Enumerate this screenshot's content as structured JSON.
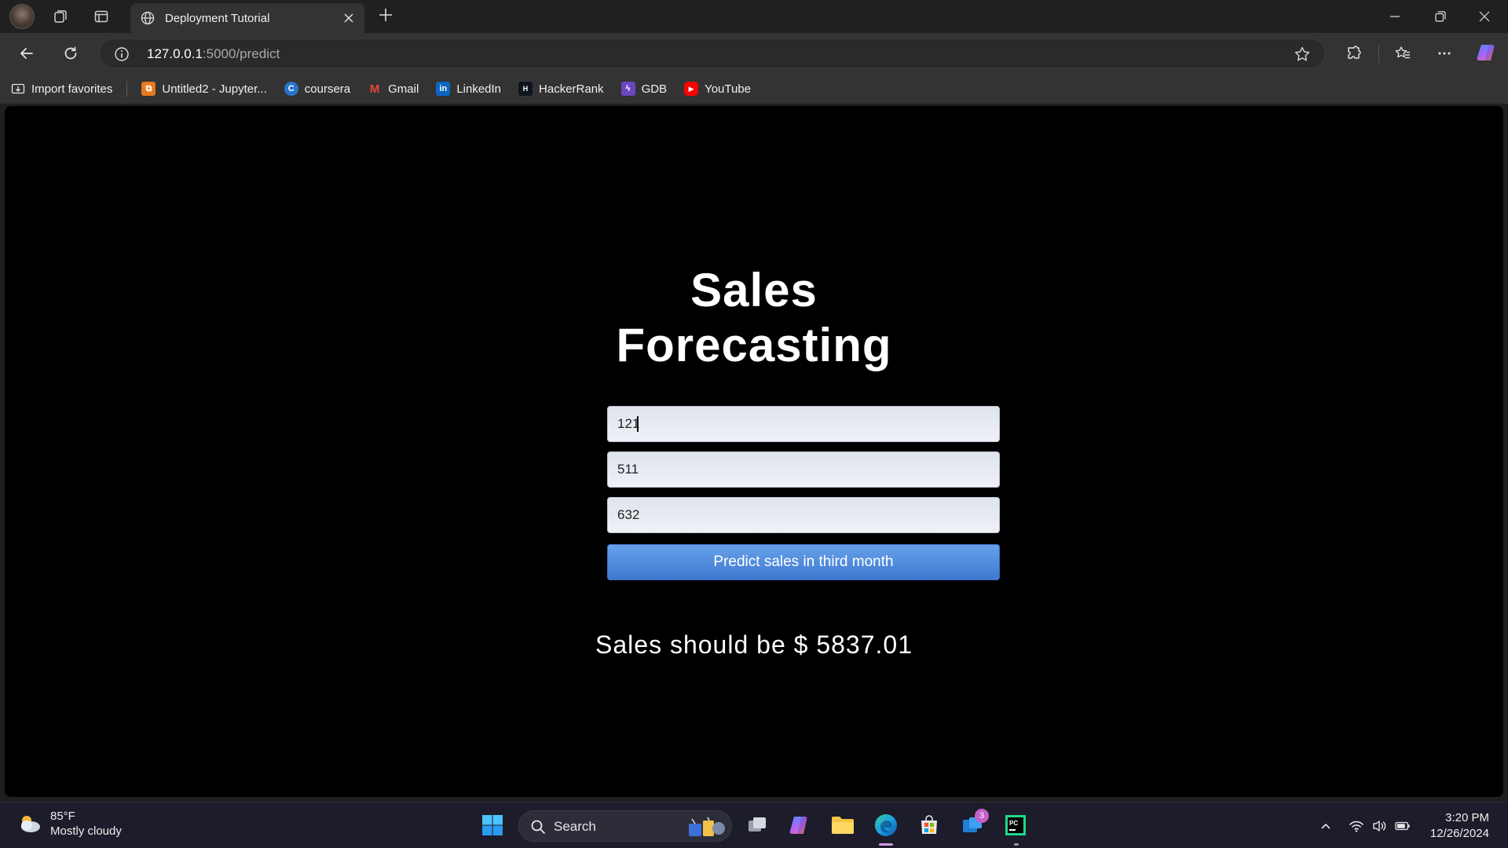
{
  "browser": {
    "tab_title": "Deployment Tutorial",
    "url_host": "127.0.0.1",
    "url_rest": ":5000/predict"
  },
  "bookmarks": [
    {
      "label": "Import favorites",
      "icon": "import-icon"
    },
    {
      "label": "Untitled2 - Jupyter...",
      "icon": "jupyter-icon",
      "color": "#e8781e"
    },
    {
      "label": "coursera",
      "icon": "coursera-icon",
      "color": "#2a73cc"
    },
    {
      "label": "Gmail",
      "icon": "gmail-icon",
      "color": "#d93025"
    },
    {
      "label": "LinkedIn",
      "icon": "linkedin-icon",
      "color": "#0a66c2"
    },
    {
      "label": "HackerRank",
      "icon": "hackerrank-icon",
      "color": "#1ba94c"
    },
    {
      "label": "GDB",
      "icon": "gdb-icon",
      "color": "#8a5cf6"
    },
    {
      "label": "YouTube",
      "icon": "youtube-icon",
      "color": "#ff0000"
    }
  ],
  "page": {
    "title_line1": "Sales",
    "title_line2": "Forecasting",
    "inputs": [
      "121",
      "511",
      "632"
    ],
    "button_label": "Predict sales in third month",
    "result_text": "Sales should be $ 5837.01"
  },
  "taskbar": {
    "temperature": "85°F",
    "weather": "Mostly cloudy",
    "search_label": "Search",
    "store_badge": "3",
    "time": "3:20 PM",
    "date": "12/26/2024"
  },
  "colors": {
    "page_background": "#000000",
    "button_top": "#66a1ea",
    "button_bottom": "#3e78d0",
    "input_background": "#e3e7ef"
  }
}
